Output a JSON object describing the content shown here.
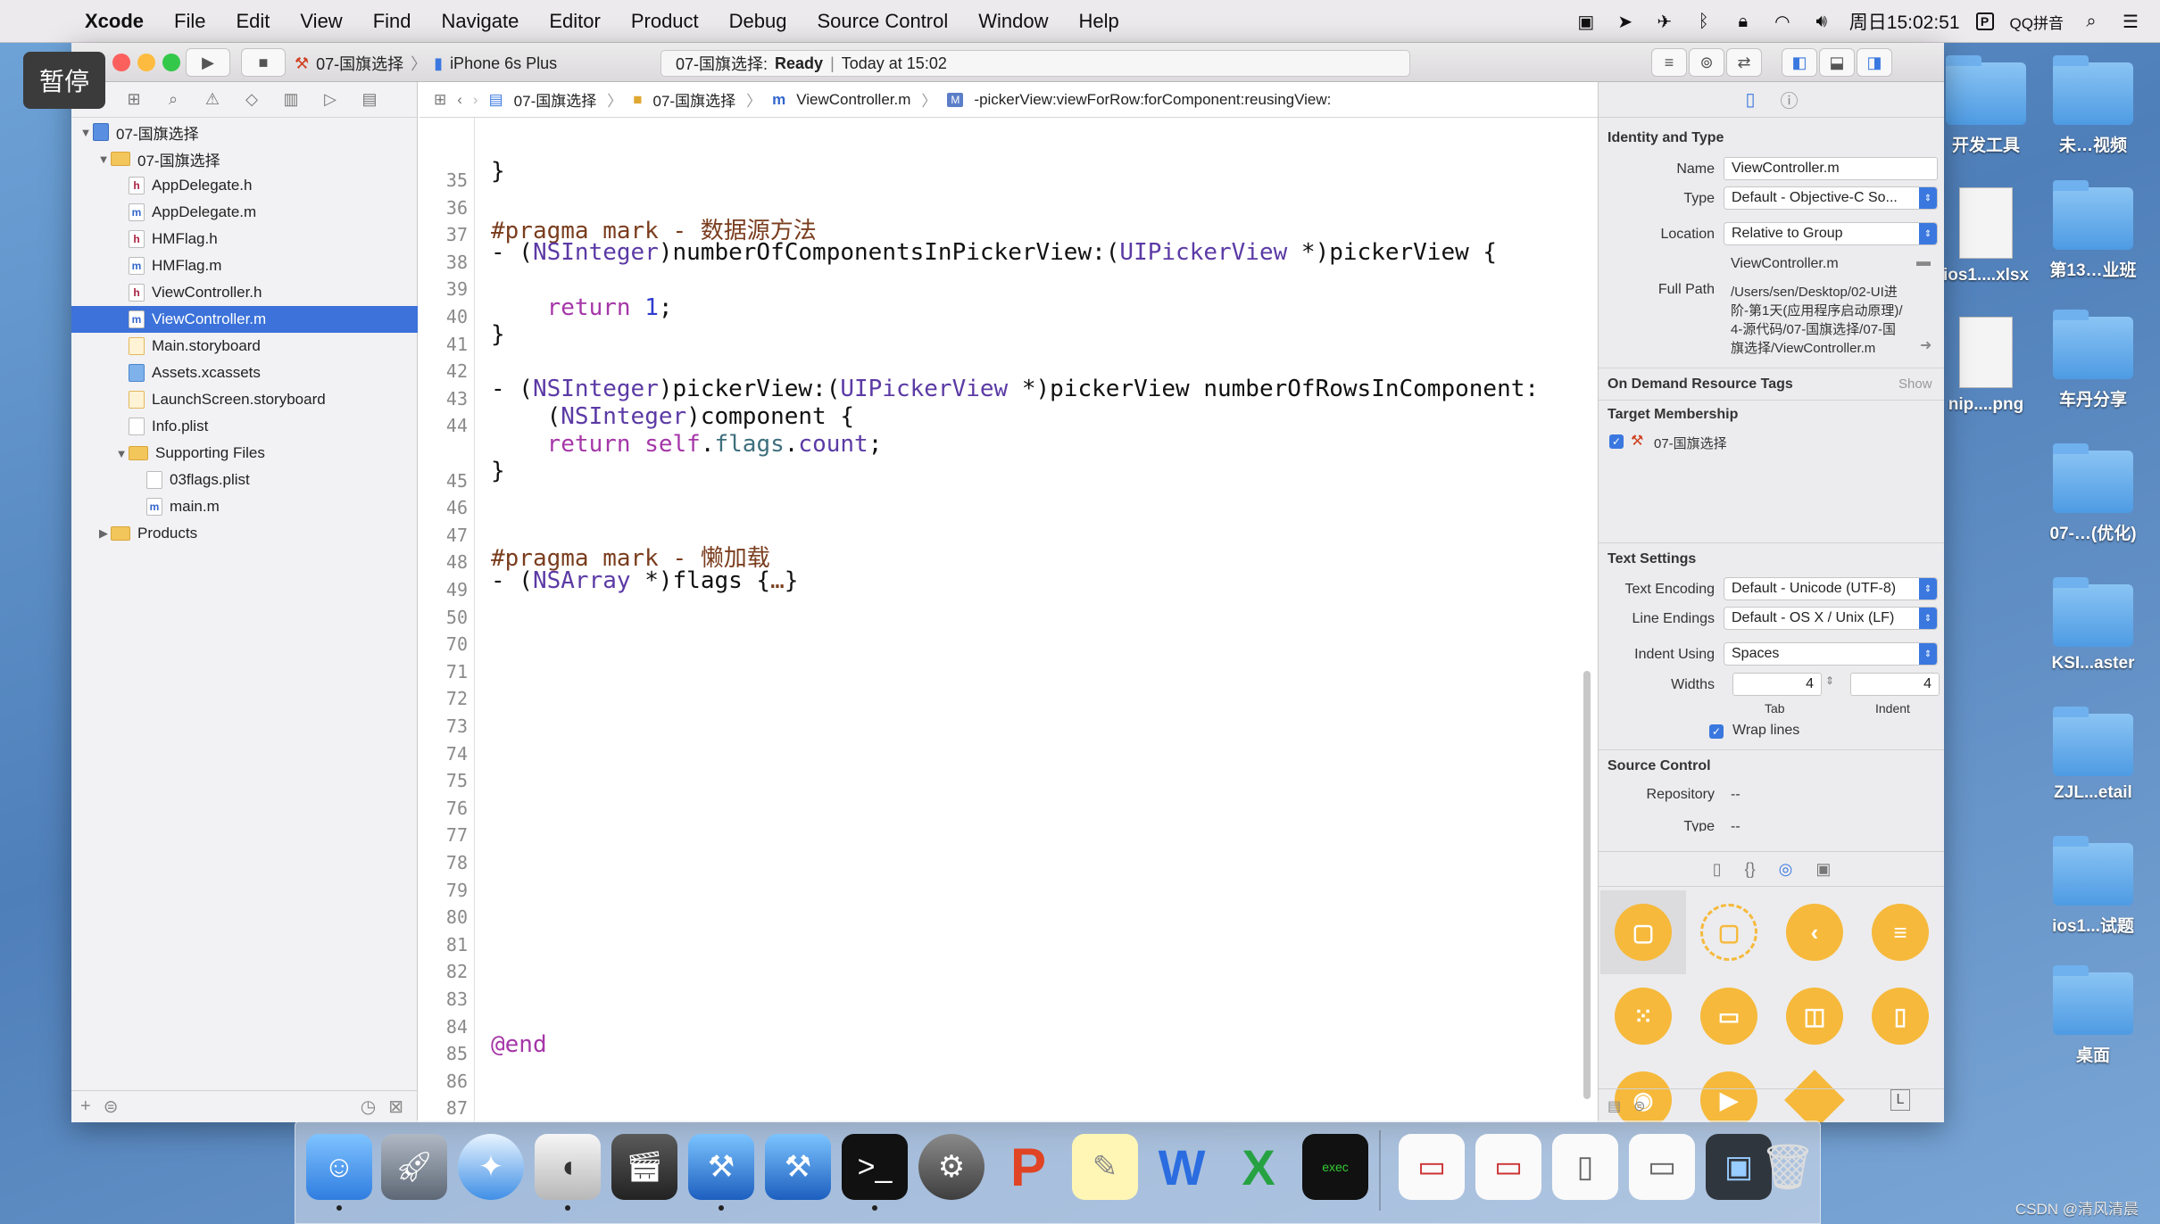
{
  "menubar": {
    "app": "Xcode",
    "items": [
      "File",
      "Edit",
      "View",
      "Find",
      "Navigate",
      "Editor",
      "Product",
      "Debug",
      "Source Control",
      "Window",
      "Help"
    ],
    "clock": "周日15:02:51",
    "input_method": "QQ拼音"
  },
  "pause_badge": "暂停",
  "toolbar": {
    "scheme": "07-国旗选择",
    "device": "iPhone 6s Plus",
    "status_project": "07-国旗选择:",
    "status_state": "Ready",
    "status_sep": "|",
    "status_time": "Today at 15:02"
  },
  "navigator": {
    "rows": [
      {
        "label": "07-国旗选择",
        "icon": "proj",
        "indent": 0,
        "disc": "▼"
      },
      {
        "label": "07-国旗选择",
        "icon": "folder",
        "indent": 1,
        "disc": "▼"
      },
      {
        "label": "AppDelegate.h",
        "icon": "h",
        "indent": 2,
        "disc": ""
      },
      {
        "label": "AppDelegate.m",
        "icon": "m",
        "indent": 2,
        "disc": ""
      },
      {
        "label": "HMFlag.h",
        "icon": "h",
        "indent": 2,
        "disc": ""
      },
      {
        "label": "HMFlag.m",
        "icon": "m",
        "indent": 2,
        "disc": ""
      },
      {
        "label": "ViewController.h",
        "icon": "h",
        "indent": 2,
        "disc": ""
      },
      {
        "label": "ViewController.m",
        "icon": "m",
        "indent": 2,
        "disc": "",
        "selected": true
      },
      {
        "label": "Main.storyboard",
        "icon": "sb",
        "indent": 2,
        "disc": ""
      },
      {
        "label": "Assets.xcassets",
        "icon": "assets",
        "indent": 2,
        "disc": ""
      },
      {
        "label": "LaunchScreen.storyboard",
        "icon": "sb",
        "indent": 2,
        "disc": ""
      },
      {
        "label": "Info.plist",
        "icon": "plist",
        "indent": 2,
        "disc": ""
      },
      {
        "label": "Supporting Files",
        "icon": "folder",
        "indent": 2,
        "disc": "▼"
      },
      {
        "label": "03flags.plist",
        "icon": "plist",
        "indent": 3,
        "disc": ""
      },
      {
        "label": "main.m",
        "icon": "m",
        "indent": 3,
        "disc": ""
      },
      {
        "label": "Products",
        "icon": "folder",
        "indent": 1,
        "disc": "▶"
      }
    ]
  },
  "jumpbar": {
    "crumbs": [
      "07-国旗选择",
      "07-国旗选择",
      "ViewController.m",
      "-pickerView:viewForRow:forComponent:reusingView:"
    ]
  },
  "editor": {
    "lines": [
      {
        "n": "35",
        "segs": []
      },
      {
        "n": "36",
        "segs": [
          {
            "t": "}",
            "c": ""
          }
        ]
      },
      {
        "n": "37",
        "segs": []
      },
      {
        "n": "38",
        "segs": [
          {
            "t": "#pragma mark - 数据源方法",
            "c": "kw-brown"
          }
        ]
      },
      {
        "n": "39",
        "segs": [
          {
            "t": "- (",
            "c": ""
          },
          {
            "t": "NSInteger",
            "c": "kw-type"
          },
          {
            "t": ")numberOfComponentsInPickerView:(",
            "c": ""
          },
          {
            "t": "UIPickerView",
            "c": "kw-type"
          },
          {
            "t": " *)pickerView {",
            "c": ""
          }
        ]
      },
      {
        "n": "40",
        "segs": []
      },
      {
        "n": "41",
        "segs": [
          {
            "t": "    ",
            "c": ""
          },
          {
            "t": "return",
            "c": "kw-purple"
          },
          {
            "t": " ",
            "c": ""
          },
          {
            "t": "1",
            "c": "kw-blue"
          },
          {
            "t": ";",
            "c": ""
          }
        ]
      },
      {
        "n": "42",
        "segs": [
          {
            "t": "}",
            "c": ""
          }
        ]
      },
      {
        "n": "43",
        "segs": []
      },
      {
        "n": "44",
        "segs": [
          {
            "t": "- (",
            "c": ""
          },
          {
            "t": "NSInteger",
            "c": "kw-type"
          },
          {
            "t": ")pickerView:(",
            "c": ""
          },
          {
            "t": "UIPickerView",
            "c": "kw-type"
          },
          {
            "t": " *)pickerView numberOfRowsInComponent:",
            "c": ""
          }
        ]
      },
      {
        "n": "",
        "segs": [
          {
            "t": "    (",
            "c": ""
          },
          {
            "t": "NSInteger",
            "c": "kw-type"
          },
          {
            "t": ")component {",
            "c": ""
          }
        ]
      },
      {
        "n": "45",
        "segs": [
          {
            "t": "    ",
            "c": ""
          },
          {
            "t": "return",
            "c": "kw-purple"
          },
          {
            "t": " ",
            "c": ""
          },
          {
            "t": "self",
            "c": "kw-purple"
          },
          {
            "t": ".",
            "c": ""
          },
          {
            "t": "flags",
            "c": "kw-teal"
          },
          {
            "t": ".",
            "c": ""
          },
          {
            "t": "count",
            "c": "kw-type"
          },
          {
            "t": ";",
            "c": ""
          }
        ]
      },
      {
        "n": "46",
        "segs": [
          {
            "t": "}",
            "c": ""
          }
        ]
      },
      {
        "n": "47",
        "segs": []
      },
      {
        "n": "48",
        "segs": []
      },
      {
        "n": "49",
        "segs": [
          {
            "t": "#pragma mark - 懒加载",
            "c": "kw-brown"
          }
        ]
      },
      {
        "n": "50",
        "segs": [
          {
            "t": "- (",
            "c": ""
          },
          {
            "t": "NSArray",
            "c": "kw-type"
          },
          {
            "t": " *)flags {",
            "c": ""
          },
          {
            "t": "…",
            "c": "kw-brown"
          },
          {
            "t": "}",
            "c": ""
          }
        ]
      },
      {
        "n": "70",
        "segs": []
      },
      {
        "n": "71",
        "segs": []
      },
      {
        "n": "72",
        "segs": []
      },
      {
        "n": "73",
        "segs": []
      },
      {
        "n": "74",
        "segs": []
      },
      {
        "n": "75",
        "segs": []
      },
      {
        "n": "76",
        "segs": []
      },
      {
        "n": "77",
        "segs": []
      },
      {
        "n": "78",
        "segs": []
      },
      {
        "n": "79",
        "segs": []
      },
      {
        "n": "80",
        "segs": []
      },
      {
        "n": "81",
        "segs": []
      },
      {
        "n": "82",
        "segs": []
      },
      {
        "n": "83",
        "segs": []
      },
      {
        "n": "84",
        "segs": []
      },
      {
        "n": "85",
        "segs": []
      },
      {
        "n": "86",
        "segs": [
          {
            "t": "@end",
            "c": "kw-purple"
          }
        ]
      },
      {
        "n": "87",
        "segs": []
      }
    ]
  },
  "utilities": {
    "identity_title": "Identity and Type",
    "name_label": "Name",
    "name_value": "ViewController.m",
    "type_label": "Type",
    "type_value": "Default - Objective-C So...",
    "location_label": "Location",
    "location_value": "Relative to Group",
    "location_file": "ViewController.m",
    "fullpath_label": "Full Path",
    "fullpath_lines": [
      "/Users/sen/Desktop/02-UI进",
      "阶-第1天(应用程序启动原理)/",
      "4-源代码/07-国旗选择/07-国",
      "旗选择/ViewController.m"
    ],
    "odr_title": "On Demand Resource Tags",
    "odr_show": "Show",
    "target_title": "Target Membership",
    "target_name": "07-国旗选择",
    "text_title": "Text Settings",
    "encoding_label": "Text Encoding",
    "encoding_value": "Default - Unicode (UTF-8)",
    "endings_label": "Line Endings",
    "endings_value": "Default - OS X / Unix (LF)",
    "indent_label": "Indent Using",
    "indent_value": "Spaces",
    "widths_label": "Widths",
    "tab_value": "4",
    "indent_width_value": "4",
    "tab_caption": "Tab",
    "indent_caption": "Indent",
    "wrap_label": "Wrap lines",
    "sc_title": "Source Control",
    "repo_label": "Repository",
    "repo_value": "--",
    "sctype_label": "Type",
    "sctype_value": "--"
  },
  "desktop": {
    "icons": [
      {
        "label": "开发工具",
        "kind": "folder"
      },
      {
        "label": "未…视频",
        "kind": "folder"
      },
      {
        "label": "ios1....xlsx",
        "kind": "file"
      },
      {
        "label": "第13…业班",
        "kind": "folder"
      },
      {
        "label": "nip....png",
        "kind": "file"
      },
      {
        "label": "车丹分享",
        "kind": "folder"
      },
      {
        "label": "07-…(优化)",
        "kind": "folder"
      },
      {
        "label": "KSI...aster",
        "kind": "folder"
      },
      {
        "label": "ZJL...etail",
        "kind": "folder"
      },
      {
        "label": "ios1...试题",
        "kind": "folder"
      },
      {
        "label": "桌面",
        "kind": "folder"
      }
    ]
  },
  "watermark": "CSDN @清风清晨",
  "colors": {
    "selection": "#3c72d9",
    "library_orange": "#f6b93b",
    "checkbox": "#3a78e0"
  }
}
